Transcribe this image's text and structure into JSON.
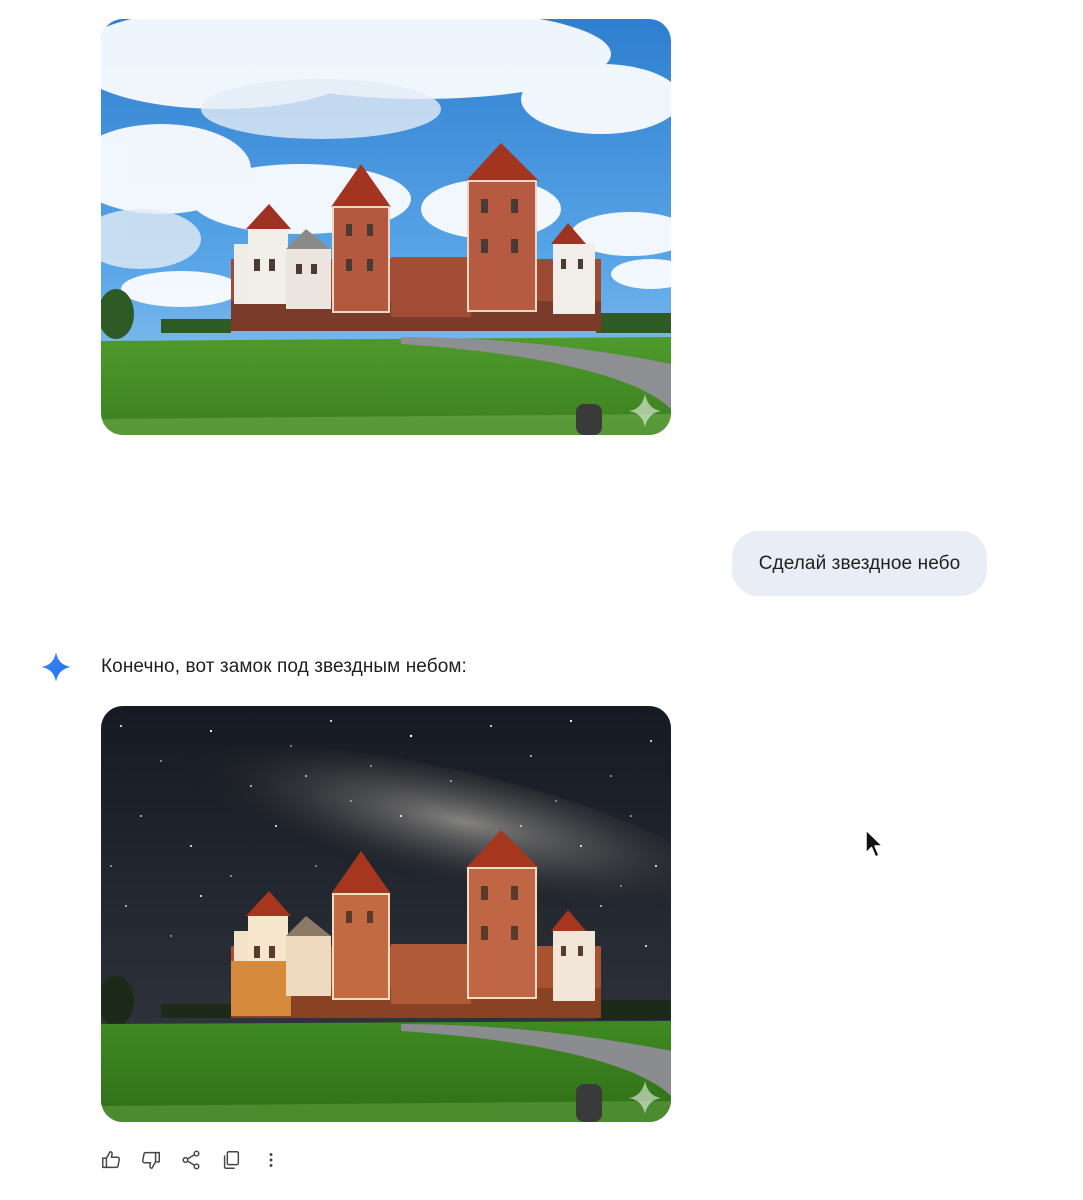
{
  "conversation": {
    "user_message": "Сделай звездное небо",
    "assistant_reply": "Конечно, вот замок под звездным небом:"
  },
  "images": {
    "original": {
      "subject": "Mir Castle at daytime under blue cloudy sky",
      "alt": ""
    },
    "generated": {
      "subject": "Mir Castle under a starry Milky Way night sky",
      "alt": ""
    }
  },
  "actions": [
    {
      "name": "thumbs-up-icon"
    },
    {
      "name": "thumbs-down-icon"
    },
    {
      "name": "share-icon"
    },
    {
      "name": "copy-icon"
    },
    {
      "name": "more-vert-icon"
    }
  ],
  "colors": {
    "user_bubble": "#e9eef6",
    "gemini_star_a": "#4285f4",
    "gemini_star_b": "#1a73e8",
    "icon_gray": "#444746"
  }
}
